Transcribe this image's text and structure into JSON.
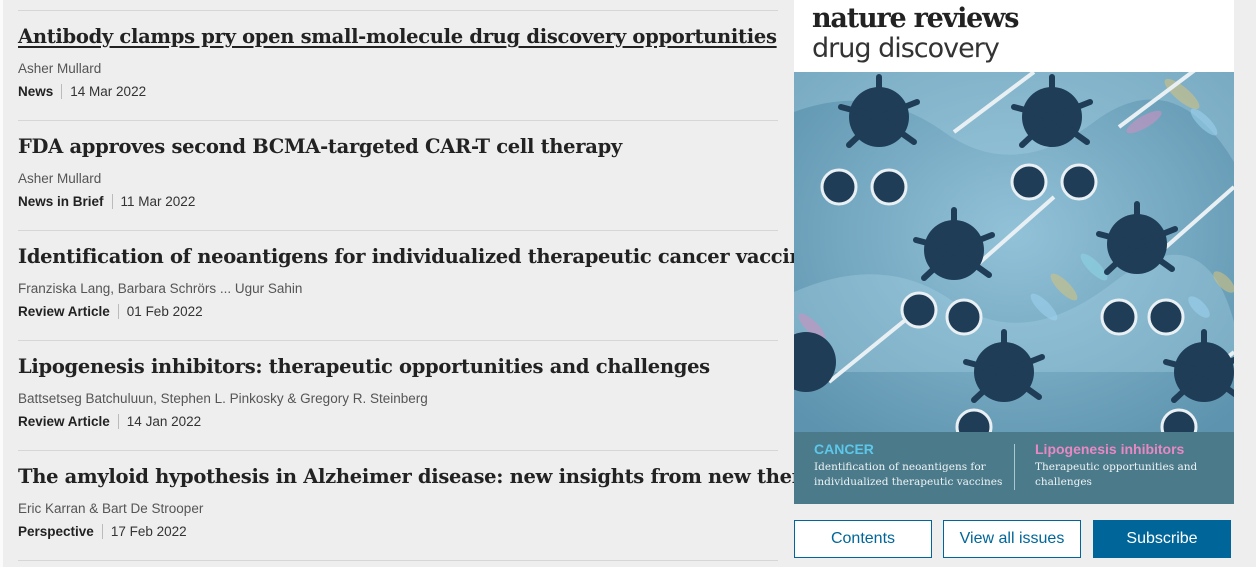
{
  "articles": [
    {
      "title": "Antibody clamps pry open small-molecule drug discovery opportunities",
      "authors": "Asher Mullard",
      "type": "News",
      "date": "14 Mar 2022"
    },
    {
      "title": "FDA approves second BCMA-targeted CAR-T cell therapy",
      "authors": "Asher Mullard",
      "type": "News in Brief",
      "date": "11 Mar 2022"
    },
    {
      "title": "Identification of neoantigens for individualized therapeutic cancer vaccines",
      "authors": "Franziska Lang, Barbara Schrörs ... Ugur Sahin",
      "type": "Review Article",
      "date": "01 Feb 2022"
    },
    {
      "title": "Lipogenesis inhibitors: therapeutic opportunities and challenges",
      "authors": "Battsetseg Batchuluun, Stephen L. Pinkosky & Gregory R. Steinberg",
      "type": "Review Article",
      "date": "14 Jan 2022"
    },
    {
      "title": "The amyloid hypothesis in Alzheimer disease: new insights from new therapeutics",
      "authors": "Eric Karran & Bart De Strooper",
      "type": "Perspective",
      "date": "17 Feb 2022"
    }
  ],
  "cover": {
    "brand_line1": "nature reviews",
    "brand_line2": "drug discovery",
    "left_heading": "CANCER",
    "left_text": "Identification of neoantigens for individualized therapeutic vaccines",
    "right_heading": "Lipogenesis inhibitors",
    "right_text": "Therapeutic opportunities and challenges"
  },
  "buttons": {
    "contents": "Contents",
    "view_all": "View all issues",
    "subscribe": "Subscribe"
  },
  "colors": {
    "link_blue": "#006699",
    "cancer_cyan": "#5dc7ea",
    "lipogenesis_pink": "#e889c4"
  }
}
